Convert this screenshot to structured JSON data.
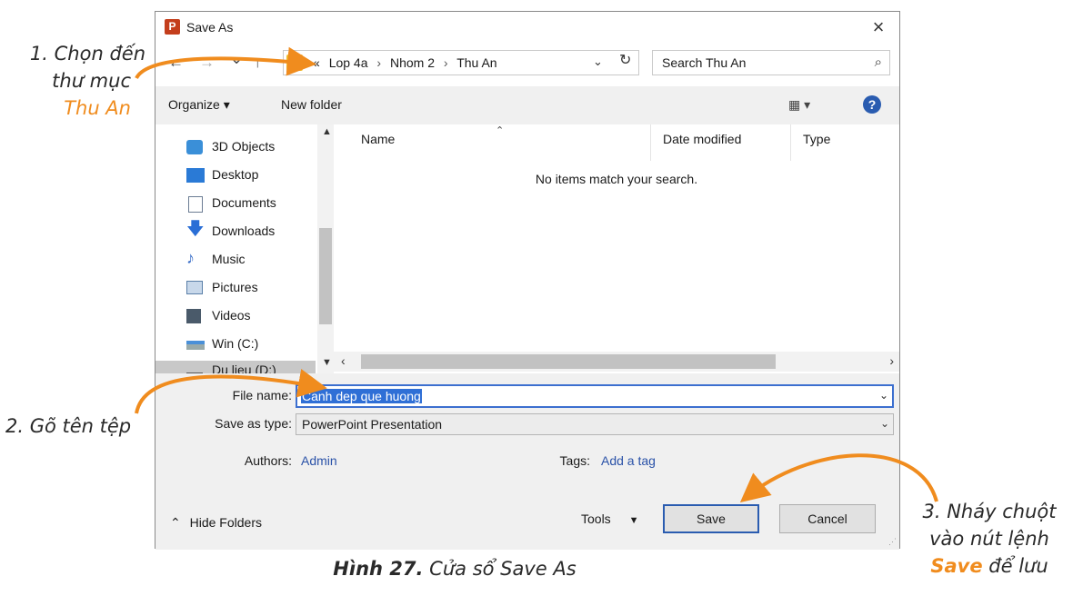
{
  "dialog": {
    "title": "Save As",
    "app_icon_letter": "P",
    "close_glyph": "×",
    "nav": {
      "back": "←",
      "forward": "→",
      "recent": "⌄",
      "up": "↑"
    },
    "address": {
      "prefix": "«",
      "crumbs": [
        "Lop 4a",
        "Nhom 2",
        "Thu An"
      ],
      "separator": "›",
      "dropdown": "⌄",
      "refresh": "↻"
    },
    "search": {
      "placeholder": "Search Thu An",
      "icon": "⌕"
    },
    "toolbar": {
      "organize": "Organize ▾",
      "new_folder": "New folder",
      "view": "▦ ▾",
      "help": "?"
    },
    "sidebar": {
      "items": [
        {
          "label": "3D Objects",
          "icon": "3d-objects-icon",
          "color": "#3a8fd8"
        },
        {
          "label": "Desktop",
          "icon": "desktop-icon",
          "color": "#2a7ad6"
        },
        {
          "label": "Documents",
          "icon": "documents-icon",
          "color": "#6b7c93"
        },
        {
          "label": "Downloads",
          "icon": "downloads-icon",
          "color": "#2a6ed6"
        },
        {
          "label": "Music",
          "icon": "music-icon",
          "color": "#3a6ec8"
        },
        {
          "label": "Pictures",
          "icon": "pictures-icon",
          "color": "#5a7fa8"
        },
        {
          "label": "Videos",
          "icon": "videos-icon",
          "color": "#4a5a6a"
        },
        {
          "label": "Win (C:)",
          "icon": "drive-c-icon",
          "color": "#4a90d8"
        },
        {
          "label": "Du lieu (D:)",
          "icon": "drive-d-icon",
          "color": "#555555"
        }
      ],
      "selected_index": 8
    },
    "columns": [
      "Name",
      "Date modified",
      "Type"
    ],
    "empty_message": "No items match your search.",
    "file_name": {
      "label": "File name:",
      "value": "Canh dep que huong"
    },
    "save_as_type": {
      "label": "Save as type:",
      "value": "PowerPoint Presentation"
    },
    "authors": {
      "label": "Authors:",
      "value": "Admin"
    },
    "tags": {
      "label": "Tags:",
      "value": "Add a tag"
    },
    "hide_folders": "Hide Folders",
    "tools": "Tools",
    "buttons": {
      "save": "Save",
      "cancel": "Cancel"
    }
  },
  "annotations": {
    "step1_line1": "1. Chọn đến",
    "step1_line2": "thư mục",
    "step1_folder": "Thu An",
    "step2": "2. Gõ tên tệp",
    "step3_line1": "3. Nháy chuột",
    "step3_line2": "vào nút lệnh",
    "step3_bold": "Save",
    "step3_tail": "để lưu"
  },
  "caption": {
    "bold": "Hình 27.",
    "text": "Cửa sổ Save As"
  },
  "colors": {
    "annotation_accent": "#f08c1e",
    "selection": "#2f6fd6",
    "link": "#2a52a8"
  }
}
